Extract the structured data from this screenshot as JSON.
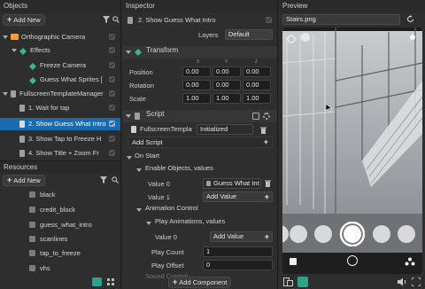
{
  "left": {
    "objects_title": "Objects",
    "add_new": "Add New",
    "tree": [
      {
        "label": "Orthographic Camera"
      },
      {
        "label": "Effects"
      },
      {
        "label": "Freeze Camera"
      },
      {
        "label": "Guess What Sprites ["
      },
      {
        "label": "FullscreenTemplateManager"
      },
      {
        "label": "1. Wait for tap"
      },
      {
        "label": "2. Show Guess What Intro"
      },
      {
        "label": "3. Show Tap to Freeze H"
      },
      {
        "label": "4. Show Title + Zoom Fr"
      }
    ],
    "resources_title": "Resources",
    "res_add_new": "Add New",
    "resources": [
      "black",
      "credit_block",
      "guess_what_intro",
      "scanlines",
      "tap_to_freeze",
      "vhs"
    ]
  },
  "inspector": {
    "title": "Inspector",
    "object_name": "2. Show Guess What Intro",
    "layers_label": "Layers",
    "layers_value": "Default",
    "transform": {
      "title": "Transform",
      "axes": [
        "X",
        "Y",
        "Z"
      ],
      "rows": [
        {
          "label": "Position",
          "values": [
            "0.00",
            "0.00",
            "0.00"
          ]
        },
        {
          "label": "Rotation",
          "values": [
            "0.00",
            "0.00",
            "0.00"
          ]
        },
        {
          "label": "Scale",
          "values": [
            "1.00",
            "1.00",
            "1.00"
          ]
        }
      ]
    },
    "script": {
      "title": "Script",
      "file": "FullscreenTempla",
      "status": "Initialized",
      "add_script": "Add Script"
    },
    "on_start": "On Start",
    "enable_objects": "Enable Objects, values",
    "value0_label": "Value 0",
    "value0": "Guess What Int",
    "value1_label": "Value 1",
    "add_value": "Add Value",
    "animation_control": "Animation Control",
    "play_animations": "Play Animations, values",
    "anim_value0_label": "Value 0",
    "anim_add_value": "Add Value",
    "play_count_label": "Play Count",
    "play_count": "1",
    "play_offset_label": "Play Offset",
    "play_offset": "0",
    "sound_control": "Sound Control",
    "add_component": "Add Component"
  },
  "preview": {
    "title": "Preview",
    "file": "Stairs.png"
  }
}
